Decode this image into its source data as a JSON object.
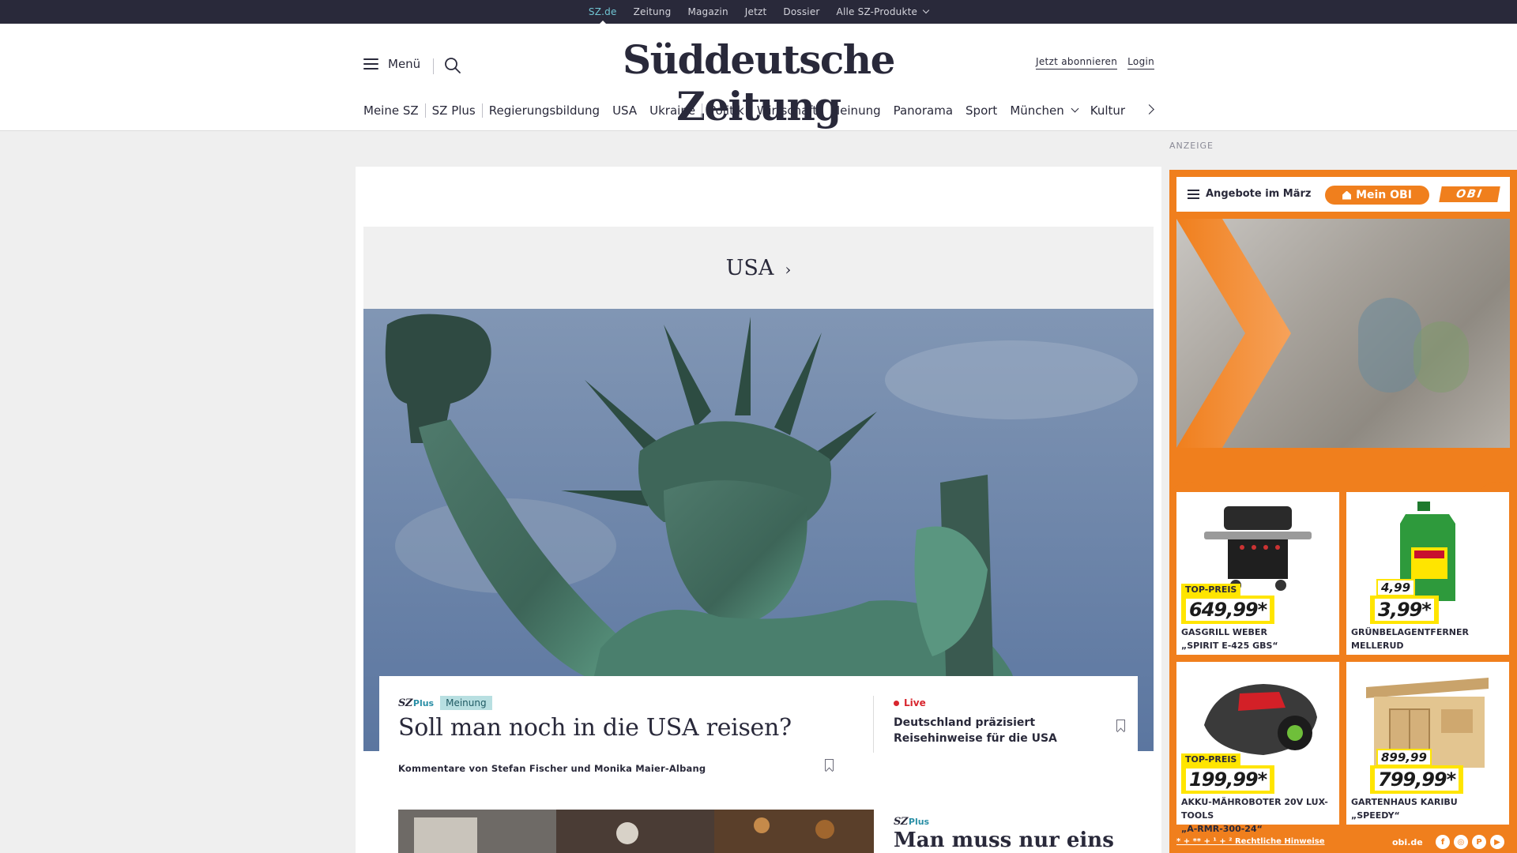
{
  "topbar": {
    "links": [
      {
        "label": "SZ.de",
        "active": true
      },
      {
        "label": "Zeitung"
      },
      {
        "label": "Magazin"
      },
      {
        "label": "Jetzt"
      },
      {
        "label": "Dossier"
      },
      {
        "label": "Alle SZ-Produkte",
        "has_dropdown": true
      }
    ]
  },
  "header": {
    "menu_label": "Menü",
    "logo": "Süddeutsche Zeitung",
    "subscribe_label": "Jetzt abonnieren",
    "login_label": "Login"
  },
  "nav": {
    "items": [
      "Meine SZ",
      "SZ Plus",
      "Regierungsbildung",
      "USA",
      "Ukraine",
      "Politik",
      "Wirtschaft",
      "Meinung",
      "Panorama",
      "Sport",
      "München",
      "Kultur"
    ]
  },
  "section": {
    "title": "USA",
    "arrow": "›"
  },
  "lead": {
    "brand_sz": "SZ",
    "brand_plus": "Plus",
    "badge": "Meinung",
    "title": "Soll man noch in die USA reisen?",
    "author": "Kommentare von Stefan Fischer und Monika Maier-Albang"
  },
  "side": {
    "live_label": "Live",
    "title": "Deutschland präzisiert Reisehinweise für die USA"
  },
  "teaser2": {
    "brand_sz": "SZ",
    "brand_plus": "Plus",
    "title": "Man muss nur eins"
  },
  "ad": {
    "label": "ANZEIGE",
    "menu_label": "Angebote im März",
    "cta_label": "Mein OBI",
    "logo": "OBI",
    "tiles": [
      {
        "tag": "TOP-PREIS",
        "price": "649,99*",
        "name_1": "Gasgrill Weber",
        "name_2": "„Spirit E-425 GBS“"
      },
      {
        "old_price": "4,99",
        "price": "3,99*",
        "name_1": "Grünbelagentferner",
        "name_2": "Mellerud"
      },
      {
        "tag": "TOP-PREIS",
        "price": "199,99*",
        "name_1": "Akku-Mähroboter 20V Lux-Tools",
        "name_2": "„A-RMR-300-24“"
      },
      {
        "old_price": "899,99",
        "price": "799,99*",
        "name_1": "Gartenhaus Karibu „Speedy“",
        "name_2": ""
      }
    ],
    "footer_hints": "* + ** + ¹ + ² Rechtliche Hinweise",
    "footer_domain": "obi.de",
    "social": [
      "f",
      "ig",
      "p",
      "yt"
    ],
    "brand_color": "#f07f1d",
    "price_color": "#ffe500"
  },
  "colors": {
    "topbar_bg": "#29293a",
    "topbar_active": "#71c6d4",
    "text": "#29293a",
    "live": "#d8262e",
    "badge_bg": "#b8dfe1"
  }
}
